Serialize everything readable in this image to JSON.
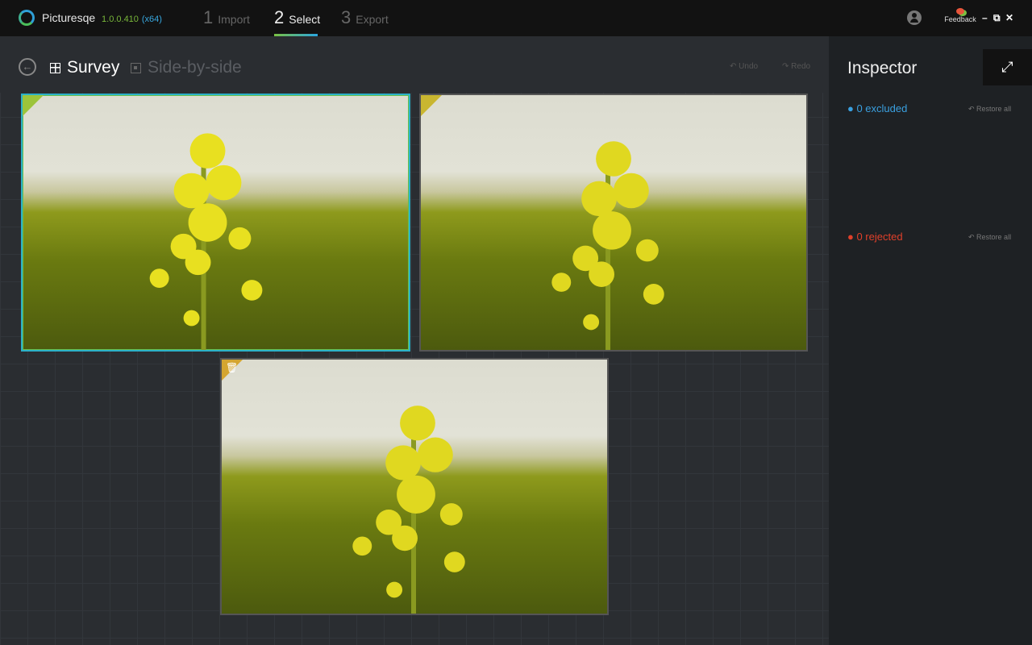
{
  "app": {
    "name": "Picturesqe",
    "version": "1.0.0.410",
    "arch": "(x64)"
  },
  "steps": [
    {
      "num": "1",
      "label": "Import"
    },
    {
      "num": "2",
      "label": "Select"
    },
    {
      "num": "3",
      "label": "Export"
    }
  ],
  "topbar": {
    "feedback": "Feedback",
    "minimize": "–",
    "restore": "⧉",
    "close": "✕"
  },
  "toolbar": {
    "back": "←",
    "survey": "Survey",
    "side_by_side": "Side-by-side",
    "undo": "↶ Undo",
    "redo": "↷ Redo"
  },
  "inspector": {
    "title": "Inspector",
    "expand": "⤢",
    "excluded": "0 excluded",
    "rejected": "0 rejected",
    "restore_all": "Restore all"
  },
  "photos": [
    {
      "state": "selected"
    },
    {
      "state": "candidate"
    },
    {
      "state": "rejected",
      "icon": "trash-icon"
    }
  ],
  "colors": {
    "accent_green": "#7ac143",
    "accent_blue": "#2aa6e0",
    "excluded": "#3aa0e0",
    "rejected": "#e0402a"
  }
}
